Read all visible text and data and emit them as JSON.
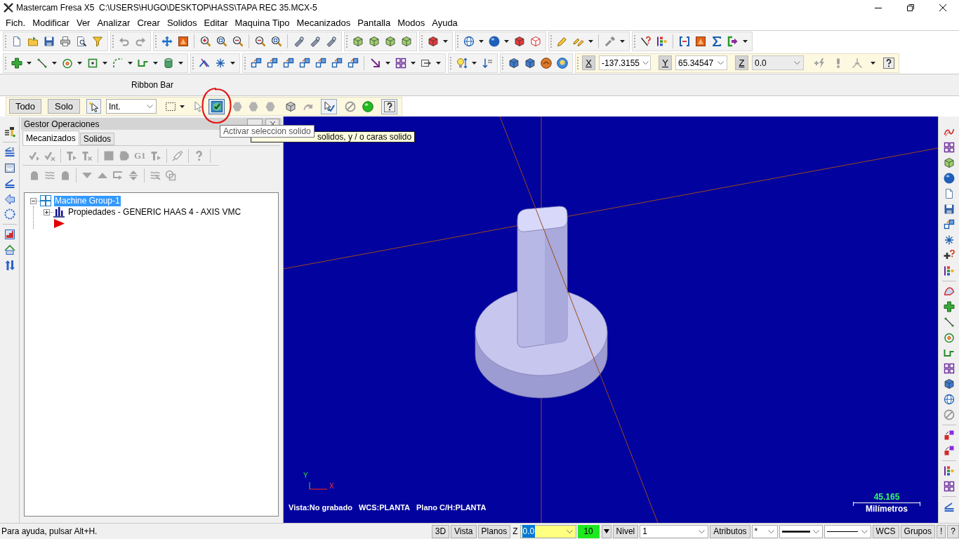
{
  "window": {
    "title": "Mastercam Fresa X5  C:\\USERS\\HUGO\\DESKTOP\\HASS\\TAPA REC 35.MCX-5"
  },
  "menu": [
    "Fich.",
    "Modificar",
    "Ver",
    "Analizar",
    "Crear",
    "Solidos",
    "Editar",
    "Maquina Tipo",
    "Mecanizados",
    "Pantalla",
    "Modos",
    "Ayuda"
  ],
  "coordinates": [
    {
      "axis": "X",
      "value": "-137.3155",
      "disabled": false
    },
    {
      "axis": "Y",
      "value": "65.34547",
      "disabled": false
    },
    {
      "axis": "Z",
      "value": "0.0",
      "disabled": true
    }
  ],
  "ribbon_bar": {
    "title": "Ribbon Bar",
    "buttons": [
      "Todo",
      "Solo"
    ],
    "mode": {
      "value": "Int."
    }
  },
  "tooltips": [
    {
      "text": "Activar seleccion solido"
    },
    {
      "text": "solidos, y / o caras solido"
    }
  ],
  "operations_manager": {
    "title": "Gestor Operaciones",
    "tabs": [
      {
        "label": "Mecanizados",
        "selected": true
      },
      {
        "label": "Solidos",
        "selected": false
      }
    ],
    "toolbar_label": "G1",
    "tree": [
      {
        "kind": "group",
        "label": "Machine Group-1",
        "selected": true,
        "expanded": true,
        "children": [
          {
            "kind": "properties",
            "label": "Propiedades - GENERIC HAAS 4 - AXIS VMC",
            "selected": false,
            "expanded": false
          }
        ]
      }
    ]
  },
  "viewport": {
    "axis_labels": {
      "x": "X",
      "y": "Y"
    },
    "view_info": [
      "Vista:No grabado",
      "WCS:PLANTA",
      "Plano C/H:PLANTA"
    ],
    "scale": {
      "value": "45.165",
      "unit": "Milímetros"
    }
  },
  "status_bar": {
    "help_text": "Para ayuda, pulsar Alt+H.",
    "controls": [
      {
        "kind": "button",
        "label": "3D"
      },
      {
        "kind": "button",
        "label": "Vista"
      },
      {
        "kind": "button",
        "label": "Planos"
      },
      {
        "kind": "label",
        "label": "Z"
      },
      {
        "kind": "combo",
        "value": "0.0",
        "highlighted": true,
        "color": "#ffff80"
      },
      {
        "kind": "color",
        "value": "10",
        "color": "#1ee81e"
      },
      {
        "kind": "button",
        "label": "Nivel"
      },
      {
        "kind": "combo",
        "value": "1"
      },
      {
        "kind": "button",
        "label": "Atributos"
      },
      {
        "kind": "combo",
        "value": "*"
      },
      {
        "kind": "line_style"
      },
      {
        "kind": "line_width"
      },
      {
        "kind": "button",
        "label": "WCS"
      },
      {
        "kind": "button",
        "label": "Grupos"
      },
      {
        "kind": "button",
        "label": "!"
      },
      {
        "kind": "button",
        "label": "?"
      }
    ]
  }
}
